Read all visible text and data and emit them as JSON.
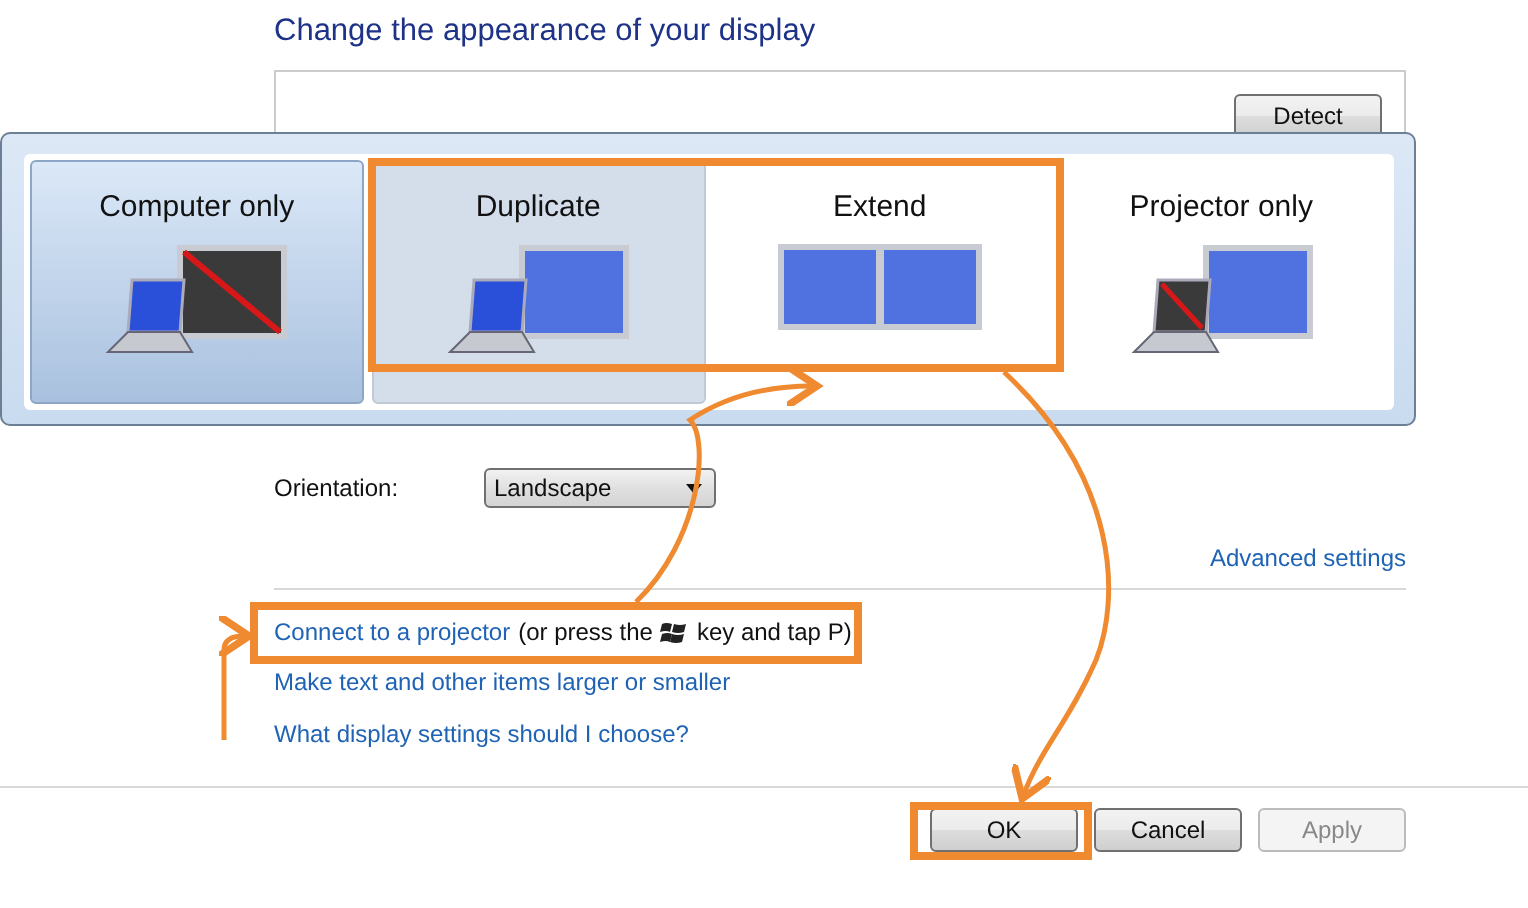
{
  "heading": "Change the appearance of your display",
  "detect_button": "Detect",
  "projection_menu": {
    "options": [
      {
        "label": "Computer only",
        "kind": "computer_only",
        "selected": true,
        "hovered": false
      },
      {
        "label": "Duplicate",
        "kind": "duplicate",
        "selected": false,
        "hovered": true
      },
      {
        "label": "Extend",
        "kind": "extend",
        "selected": false,
        "hovered": false
      },
      {
        "label": "Projector only",
        "kind": "projector_only",
        "selected": false,
        "hovered": false
      }
    ]
  },
  "orientation": {
    "label": "Orientation:",
    "value": "Landscape"
  },
  "advanced_link": "Advanced settings",
  "projector_hint": {
    "link": "Connect to a projector",
    "before_icon": "(or press the",
    "after_icon": "key and tap P)"
  },
  "links": [
    "Make text and other items larger or smaller",
    "What display settings should I choose?"
  ],
  "buttons": [
    {
      "label": "OK",
      "disabled": false
    },
    {
      "label": "Cancel",
      "disabled": false
    },
    {
      "label": "Apply",
      "disabled": true
    }
  ]
}
